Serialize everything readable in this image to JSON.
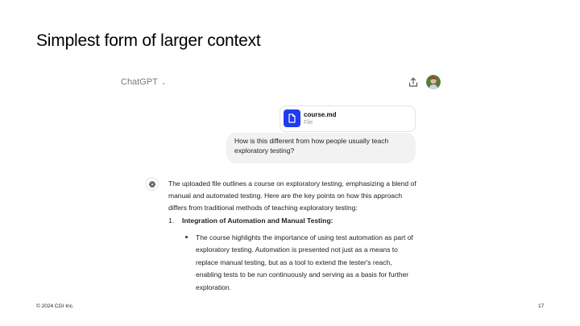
{
  "slide": {
    "title": "Simplest form of larger context",
    "footer_left": "© 2024 CGI Inc.",
    "page_number": "17"
  },
  "chat": {
    "app_title": "ChatGPT",
    "file": {
      "name": "course.md",
      "type": "File"
    },
    "user_message": "How is this different from how people usually teach exploratory testing?",
    "assistant": {
      "intro": "The uploaded file outlines a course on exploratory testing, emphasizing a blend of manual and automated testing. Here are the key points on how this approach differs from traditional methods of teaching exploratory testing:",
      "list_number": "1.",
      "list_heading": "Integration of Automation and Manual Testing:",
      "bullet": "The course highlights the importance of using test automation as part of exploratory testing. Automation is presented not just as a means to replace manual testing, but as a tool to extend the tester's reach, enabling tests to be run continuously and serving as a basis for further exploration."
    }
  },
  "colors": {
    "file_icon_bg": "#1f3cf0",
    "bubble_bg": "#f2f2f2"
  }
}
